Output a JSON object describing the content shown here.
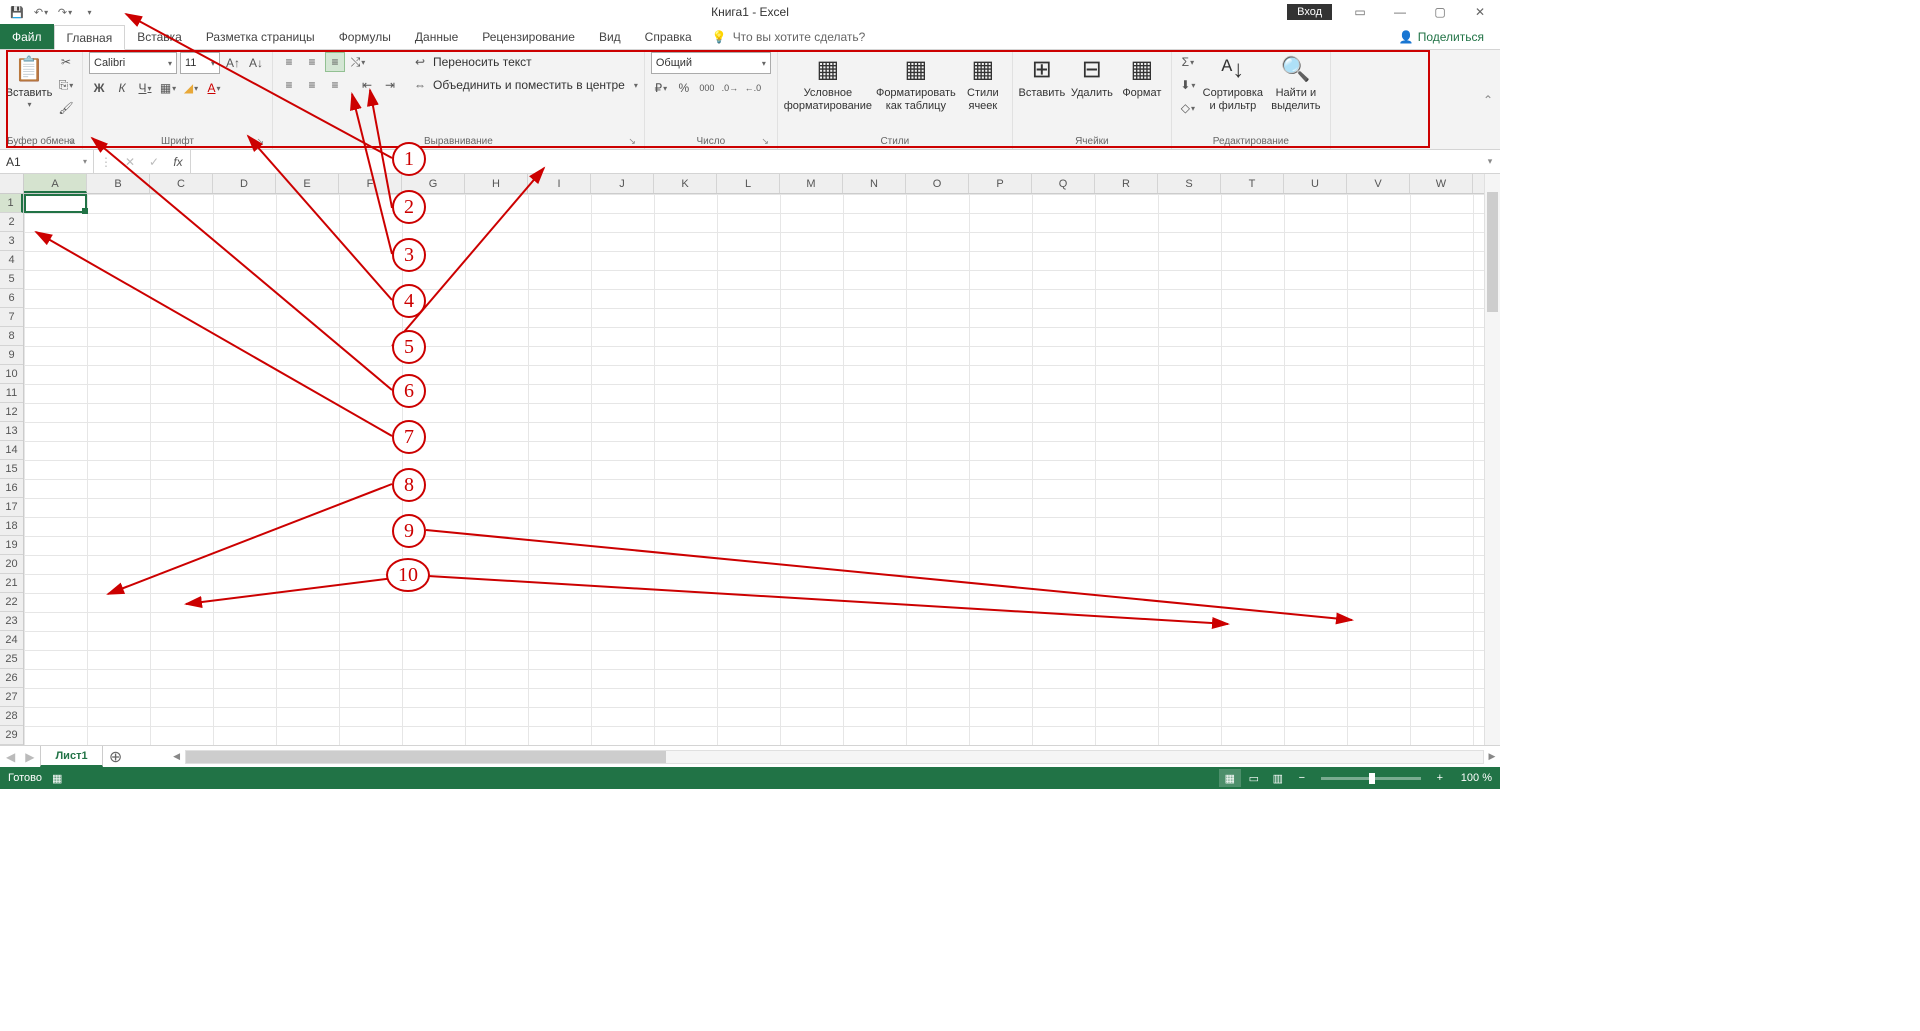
{
  "title": "Книга1  -  Excel",
  "login": "Вход",
  "tabs": {
    "file": "Файл",
    "home": "Главная",
    "insert": "Вставка",
    "layout": "Разметка страницы",
    "formulas": "Формулы",
    "data": "Данные",
    "review": "Рецензирование",
    "view": "Вид",
    "help": "Справка",
    "tellme": "Что вы хотите сделать?"
  },
  "share": "Поделиться",
  "ribbon": {
    "clipboard": {
      "paste": "Вставить",
      "label": "Буфер обмена"
    },
    "font": {
      "name": "Calibri",
      "size": "11",
      "bold": "Ж",
      "italic": "К",
      "underline": "Ч",
      "label": "Шрифт"
    },
    "align": {
      "wrap": "Переносить текст",
      "merge": "Объединить и поместить в центре",
      "label": "Выравнивание"
    },
    "number": {
      "format": "Общий",
      "label": "Число"
    },
    "styles": {
      "cond": "Условное форматирование",
      "table": "Форматировать как таблицу",
      "cell": "Стили ячеек",
      "label": "Стили"
    },
    "cells": {
      "insert": "Вставить",
      "delete": "Удалить",
      "format": "Формат",
      "label": "Ячейки"
    },
    "editing": {
      "sort": "Сортировка и фильтр",
      "find": "Найти и выделить",
      "label": "Редактирование"
    }
  },
  "namebox": "A1",
  "columns": [
    "A",
    "B",
    "C",
    "D",
    "E",
    "F",
    "G",
    "H",
    "I",
    "J",
    "K",
    "L",
    "M",
    "N",
    "O",
    "P",
    "Q",
    "R",
    "S",
    "T",
    "U",
    "V",
    "W"
  ],
  "rows": [
    "1",
    "2",
    "3",
    "4",
    "5",
    "6",
    "7",
    "8",
    "9",
    "10",
    "11",
    "12",
    "13",
    "14",
    "15",
    "16",
    "17",
    "18",
    "19",
    "20",
    "21",
    "22",
    "23",
    "24",
    "25",
    "26",
    "27",
    "28",
    "29"
  ],
  "sheet": "Лист1",
  "status": {
    "ready": "Готово",
    "zoom": "100 %"
  },
  "annot": [
    "1",
    "2",
    "3",
    "4",
    "5",
    "6",
    "7",
    "8",
    "9",
    "10"
  ]
}
